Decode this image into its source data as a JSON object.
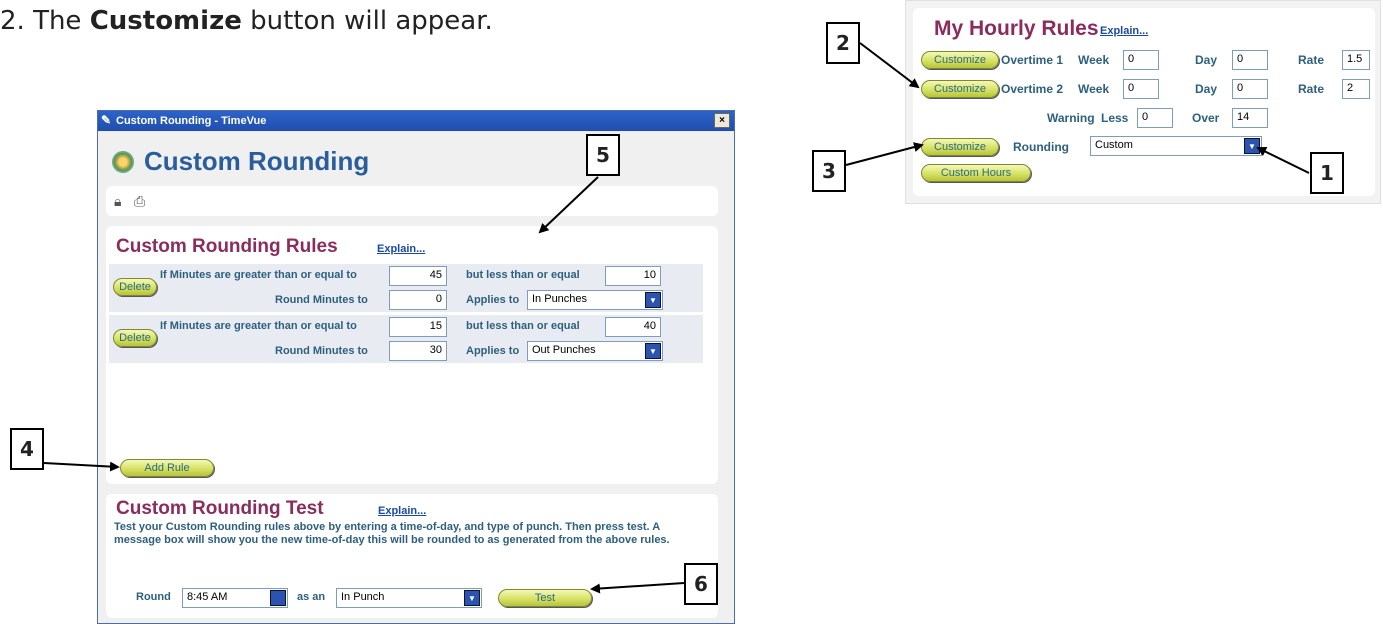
{
  "intro": {
    "prefix": "2.  The ",
    "bold": "Customize",
    "suffix": " button will appear."
  },
  "callouts": [
    "1",
    "2",
    "3",
    "4",
    "5",
    "6"
  ],
  "hourly": {
    "title": "My Hourly Rules",
    "explain": "Explain...",
    "rows": [
      {
        "button": "Customize",
        "label": "Overtime 1",
        "week_label": "Week",
        "week": "0",
        "day_label": "Day",
        "day": "0",
        "rate_label": "Rate",
        "rate": "1.5"
      },
      {
        "button": "Customize",
        "label": "Overtime 2",
        "week_label": "Week",
        "week": "0",
        "day_label": "Day",
        "day": "0",
        "rate_label": "Rate",
        "rate": "2"
      }
    ],
    "warning": {
      "label": "Warning",
      "less_label": "Less",
      "less": "0",
      "over_label": "Over",
      "over": "14"
    },
    "rounding": {
      "button": "Customize",
      "label": "Rounding",
      "value": "Custom"
    },
    "custom_hours_button": "Custom Hours"
  },
  "window": {
    "title": "Custom Rounding - TimeVue",
    "close": "×",
    "heading": "Custom Rounding",
    "rules_title": "Custom Rounding Rules",
    "rules_explain": "Explain...",
    "rules": [
      {
        "delete": "Delete",
        "gte_label": "If Minutes are greater than or equal to",
        "gte": "45",
        "lte_label": "but less than or equal",
        "lte": "10",
        "round_label": "Round Minutes to",
        "round": "0",
        "applies_label": "Applies to",
        "applies": "In Punches"
      },
      {
        "delete": "Delete",
        "gte_label": "If Minutes are greater than or equal to",
        "gte": "15",
        "lte_label": "but less than or equal",
        "lte": "40",
        "round_label": "Round Minutes to",
        "round": "30",
        "applies_label": "Applies to",
        "applies": "Out Punches"
      }
    ],
    "add_rule": "Add Rule",
    "test_title": "Custom Rounding Test",
    "test_explain": "Explain...",
    "test_desc": "Test your Custom Rounding rules above by entering a time-of-day, and type of punch.  Then press test.  A message box will show you the new time-of-day this will be rounded to as generated from the above rules.",
    "round_label": "Round",
    "round_time": "8:45 AM",
    "as_an": "as an",
    "punch_type": "In Punch",
    "test_button": "Test"
  }
}
